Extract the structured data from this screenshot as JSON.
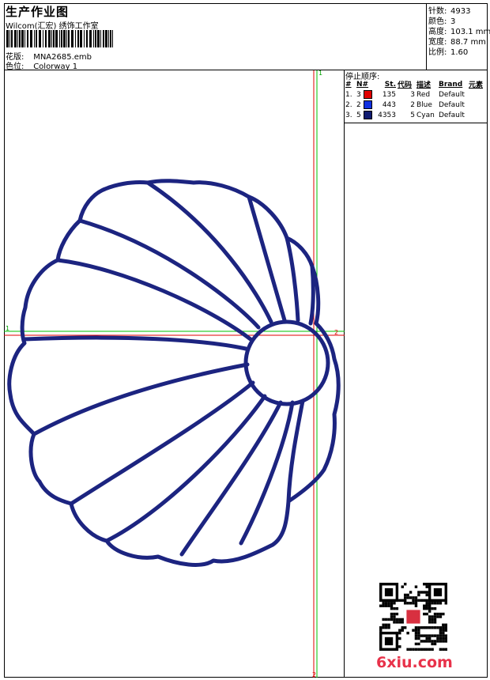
{
  "header": {
    "title": "生产作业图",
    "company": "Wilcom(汇宏) 绣饰工作室",
    "design": {
      "label": "花版:",
      "value": "MNA2685.emb"
    },
    "colorway": {
      "label": "色位:",
      "value": "Colorway 1"
    }
  },
  "stats": [
    {
      "label": "针数:",
      "value": "4933"
    },
    {
      "label": "颜色:",
      "value": "3"
    },
    {
      "label": "高度:",
      "value": "103.1 mm"
    },
    {
      "label": "宽度:",
      "value": "88.7 mm"
    },
    {
      "label": "比例:",
      "value": "1.60"
    }
  ],
  "stop_sequence": {
    "title": "停止顺序:",
    "columns": [
      "#",
      "N#",
      "St.",
      "代码",
      "描述",
      "Brand",
      "元素"
    ],
    "rows": [
      {
        "idx": "1.",
        "n": "3",
        "color": "#e00000",
        "stitches": "135",
        "code": "3",
        "desc": "Red",
        "brand": "Default"
      },
      {
        "idx": "2.",
        "n": "2",
        "color": "#1030e0",
        "stitches": "443",
        "code": "2",
        "desc": "Blue",
        "brand": "Default"
      },
      {
        "idx": "3.",
        "n": "5",
        "color": "#101c70",
        "stitches": "4353",
        "code": "5",
        "desc": "Cyan",
        "brand": "Default"
      }
    ]
  },
  "markers": {
    "top": "1",
    "left": "1",
    "right": "2",
    "bottom": "2"
  },
  "watermark": "6xiu.com",
  "colors": {
    "thread": "#1c2480",
    "axis_red": "#e00000",
    "axis_green": "#00c000"
  }
}
